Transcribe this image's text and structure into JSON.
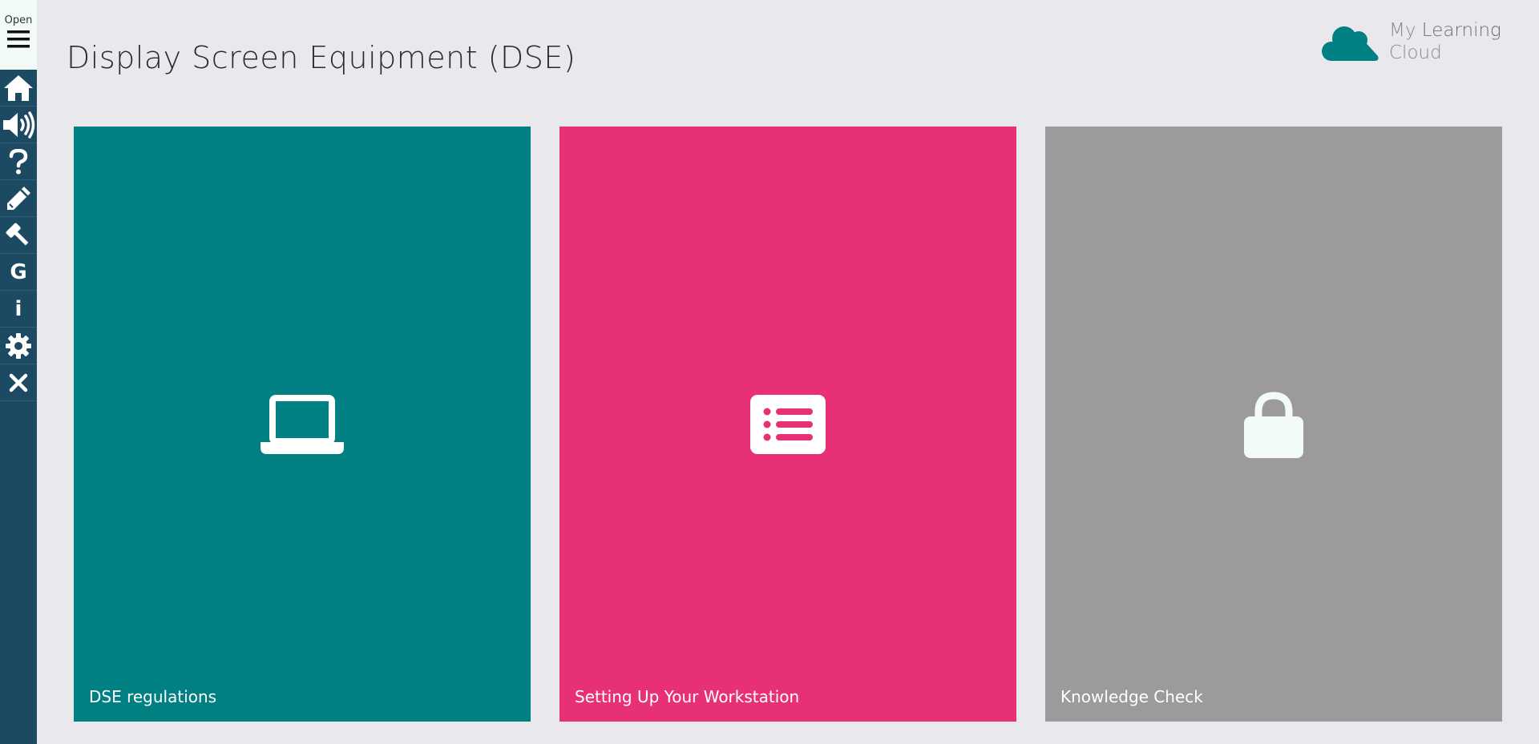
{
  "sidebar": {
    "open_label": "Open",
    "items": [
      {
        "icon": "home-icon"
      },
      {
        "icon": "volume-icon"
      },
      {
        "icon": "help-icon"
      },
      {
        "icon": "pencil-icon"
      },
      {
        "icon": "gavel-icon"
      },
      {
        "icon": "glossary-icon",
        "label": "G"
      },
      {
        "icon": "info-icon",
        "label": "i"
      },
      {
        "icon": "gear-icon"
      },
      {
        "icon": "close-icon"
      }
    ]
  },
  "header": {
    "title": "Display Screen Equipment (DSE)"
  },
  "logo": {
    "line1_light": "My",
    "line1_strong": "Learning",
    "line2": "Cloud"
  },
  "cards": [
    {
      "label": "DSE regulations",
      "icon": "laptop-icon",
      "color": "#008083"
    },
    {
      "label": "Setting Up Your Workstation",
      "icon": "list-icon",
      "color": "#e83077"
    },
    {
      "label": "Knowledge Check",
      "icon": "lock-icon",
      "color": "#9c9a9d"
    }
  ],
  "colors": {
    "background": "#e9e8ed",
    "sidebar": "#1d4a63",
    "logo_teal": "#008083"
  }
}
